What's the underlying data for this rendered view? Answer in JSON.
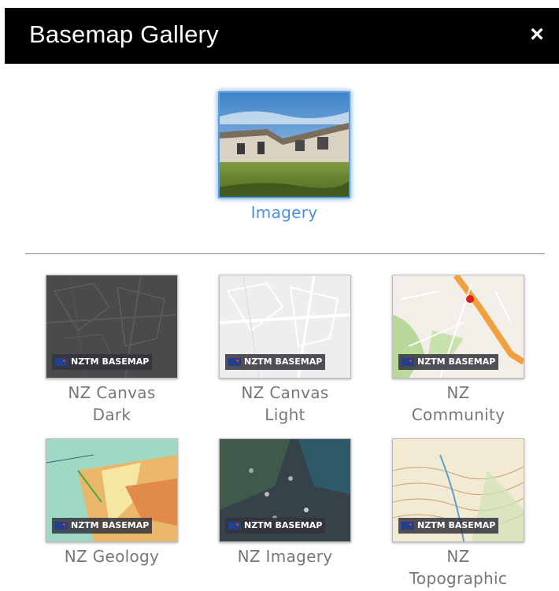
{
  "header": {
    "title": "Basemap Gallery",
    "close_glyph": "×"
  },
  "featured": {
    "label": "Imagery",
    "selected": true
  },
  "badge_text": "NZTM BASEMAP",
  "basemaps": [
    {
      "label_line1": "NZ Canvas",
      "label_line2": "Dark"
    },
    {
      "label_line1": "NZ Canvas",
      "label_line2": "Light"
    },
    {
      "label_line1": "NZ",
      "label_line2": "Community"
    },
    {
      "label_line1": "NZ Geology",
      "label_line2": ""
    },
    {
      "label_line1": "NZ Imagery",
      "label_line2": ""
    },
    {
      "label_line1": "NZ",
      "label_line2": "Topographic"
    }
  ],
  "colors": {
    "header_bg": "#000000",
    "selected_label": "#4a90e2",
    "label": "#777777",
    "selected_border": "#5b9be0"
  },
  "icons": {
    "close": "close-icon",
    "flag": "nz-flag-icon"
  }
}
